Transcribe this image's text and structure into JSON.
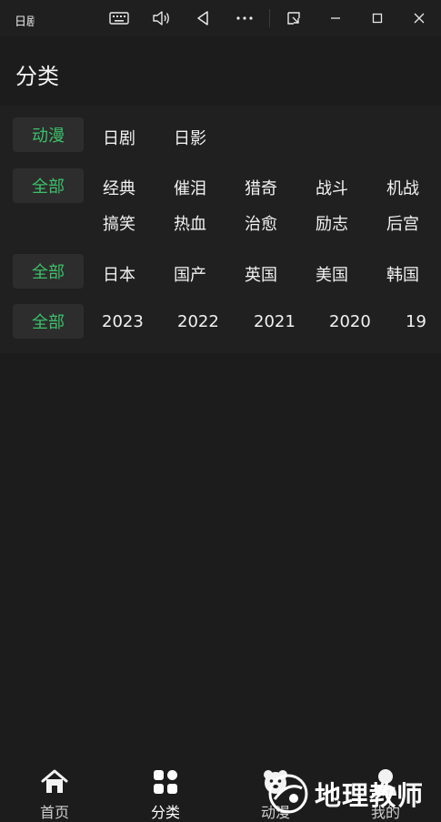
{
  "titlebar": {
    "app_title": "日剧",
    "icons": [
      "keyboard-icon",
      "volume-icon",
      "back-triangle-icon",
      "more-icon",
      "picture-in-picture-icon",
      "minimize-icon",
      "maximize-icon",
      "close-icon"
    ]
  },
  "header": {
    "title": "分类"
  },
  "filters": {
    "type": {
      "selected": "动漫",
      "options": [
        "日剧",
        "日影"
      ]
    },
    "genre": {
      "selected": "全部",
      "options": [
        "经典",
        "催泪",
        "猎奇",
        "战斗",
        "机战",
        "搞笑",
        "热血",
        "治愈",
        "励志",
        "后宫"
      ]
    },
    "region": {
      "selected": "全部",
      "options": [
        "日本",
        "国产",
        "英国",
        "美国",
        "韩国"
      ]
    },
    "year": {
      "selected": "全部",
      "options": [
        "2023",
        "2022",
        "2021",
        "2020",
        "19"
      ]
    }
  },
  "bottomnav": {
    "items": [
      {
        "label": "首页",
        "icon": "home-icon"
      },
      {
        "label": "分类",
        "icon": "category-grid-icon",
        "active": true
      },
      {
        "label": "动漫",
        "icon": "bear-icon"
      },
      {
        "label": "我的",
        "icon": "user-icon"
      }
    ]
  },
  "watermark": {
    "text": "地理教师"
  },
  "colors": {
    "accent": "#3cc06a",
    "background": "#1c1c1c",
    "panel": "#202020",
    "chip": "#2d2d2d"
  }
}
